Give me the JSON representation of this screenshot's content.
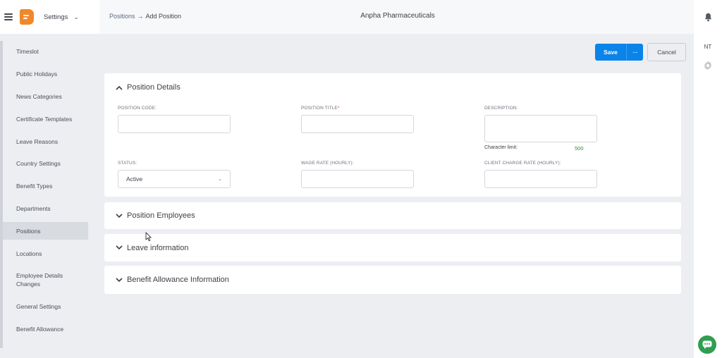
{
  "header": {
    "app_menu_label": "Settings",
    "breadcrumb_parent": "Positions",
    "breadcrumb_sep": "→",
    "breadcrumb_current": "Add Position",
    "company_name": "Anpha Pharmaceuticals"
  },
  "user": {
    "initials": "NT"
  },
  "sidebar": {
    "items": [
      {
        "label": "Timeslot"
      },
      {
        "label": "Public Holidays"
      },
      {
        "label": "News Categories"
      },
      {
        "label": "Certificate Templates"
      },
      {
        "label": "Leave Reasons"
      },
      {
        "label": "Country Settings"
      },
      {
        "label": "Benefit Types"
      },
      {
        "label": "Departments"
      },
      {
        "label": "Positions"
      },
      {
        "label": "Locations"
      },
      {
        "label": "Employee Details Changes"
      },
      {
        "label": "General Settings"
      },
      {
        "label": "Benefit Allowance"
      }
    ],
    "active": "Positions"
  },
  "actions": {
    "save_label": "Save",
    "more_label": "···",
    "cancel_label": "Cancel"
  },
  "position_details": {
    "title": "Position Details",
    "position_code": {
      "label": "POSITION CODE:",
      "value": ""
    },
    "position_title": {
      "label": "POSITION TITLE",
      "required_mark": "*",
      "value": ""
    },
    "description": {
      "label": "DESCRIPTION:",
      "value": "",
      "char_limit_label": "Character limit:",
      "char_limit_value": "500"
    },
    "status": {
      "label": "STATUS:",
      "value": "Active"
    },
    "wage_rate": {
      "label": "WAGE RATE (HOURLY):",
      "value": ""
    },
    "client_charge_rate": {
      "label": "CLIENT CHARGE RATE (HOURLY):",
      "value": ""
    }
  },
  "sections": {
    "employees": "Position Employees",
    "leave": "Leave information",
    "benefit": "Benefit Allowance Information"
  },
  "colors": {
    "primary": "#0a84e8",
    "brand": "#f0882a",
    "chat": "#2f9e51",
    "success_text": "#2e8b3a"
  }
}
